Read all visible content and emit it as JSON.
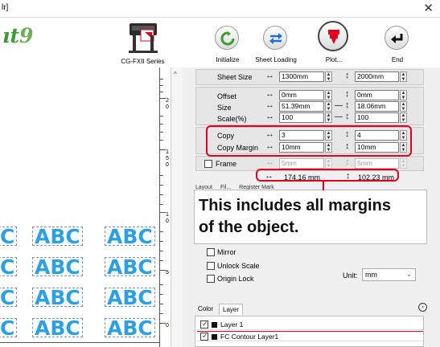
{
  "window": {
    "title": "lr]",
    "close": "✕"
  },
  "logo": {
    "text": "ıt",
    "nine": "9"
  },
  "device": {
    "label": "CG-FXII Series"
  },
  "toolbar": {
    "initialize": "Initialize",
    "sheet_loading": "Sheet Loading",
    "plot": "Plot...",
    "end": "End"
  },
  "colors": {
    "accent_red": "#e6001e",
    "abc_blue": "#2aa0e6",
    "logo_green": "#3a9e2f"
  },
  "ruler": {
    "labels": [
      "2",
      "0",
      "1",
      "5",
      "0",
      "1",
      "0",
      "5",
      "0"
    ]
  },
  "canvas": {
    "row_text": [
      "C",
      "ABC",
      "ABC"
    ]
  },
  "sheet": {
    "label": "Sheet Size",
    "width": "1300mm",
    "height": "2000mm"
  },
  "offset": {
    "label": "Offset",
    "x": "0mm",
    "y": "0mm"
  },
  "size": {
    "label": "Size",
    "x": "51.39mm",
    "y": "18.06mm"
  },
  "scale": {
    "label": "Scale(%)",
    "x": "100",
    "y": "100"
  },
  "copy": {
    "label": "Copy",
    "x": "3",
    "y": "4"
  },
  "copy_margin": {
    "label": "Copy Margin",
    "x": "10mm",
    "y": "10mm"
  },
  "frame": {
    "label": "Frame",
    "x": "5mm",
    "y": "5mm"
  },
  "totals": {
    "x": "174.16 mm",
    "y": "102.23 mm"
  },
  "tabs": [
    "Layout",
    "Fil...",
    "Register Mark"
  ],
  "callout": {
    "line1": "This includes all margins",
    "line2": "of the object."
  },
  "options": {
    "mirror": "Mirror",
    "unlock_scale": "Unlock Scale",
    "origin_lock": "Origin Lock",
    "unit_label": "Unit:",
    "unit_value": "mm"
  },
  "layer_panel": {
    "tab_color": "Color",
    "tab_layer": "Layer",
    "layers": [
      "Layer 1",
      "FC Contour Layer1"
    ]
  }
}
